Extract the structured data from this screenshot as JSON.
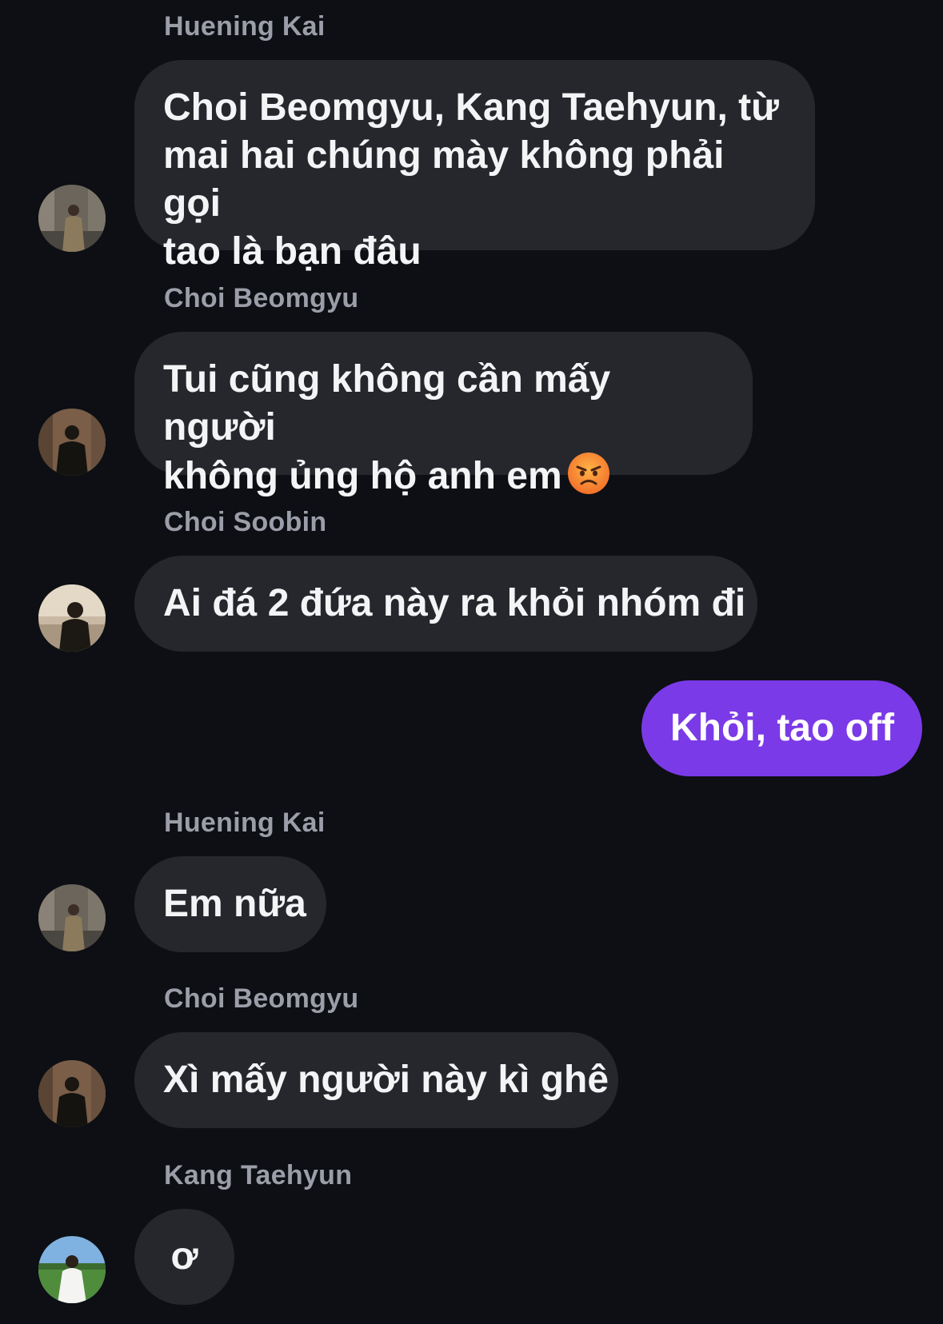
{
  "messages": [
    {
      "sender": "Huening Kai",
      "avatar_icon": "avatar-huening-kai-icon",
      "lines": [
        "Choi Beomgyu, Kang Taehyun, từ",
        "mai hai chúng mày không phải gọi",
        "tao là bạn đâu"
      ]
    },
    {
      "sender": "Choi Beomgyu",
      "avatar_icon": "avatar-choi-beomgyu-icon",
      "lines": [
        "Tui cũng không cần mấy người",
        "không ủng hộ anh em"
      ],
      "emoji": "angry-face-emoji"
    },
    {
      "sender": "Choi Soobin",
      "avatar_icon": "avatar-choi-soobin-icon",
      "text": "Ai đá 2 đứa này ra khỏi nhóm đi"
    },
    {
      "own": true,
      "text": "Khỏi, tao off"
    },
    {
      "sender": "Huening Kai",
      "avatar_icon": "avatar-huening-kai-icon",
      "text": "Em nữa"
    },
    {
      "sender": "Choi Beomgyu",
      "avatar_icon": "avatar-choi-beomgyu-icon",
      "text": "Xì mấy người này kì ghê"
    },
    {
      "sender": "Kang Taehyun",
      "avatar_icon": "avatar-kang-taehyun-icon",
      "text": "ơ"
    }
  ],
  "colors": {
    "background": "#0d0f14",
    "incoming_bubble": "#25272c",
    "outgoing_bubble": "#7b3ae8",
    "sender_name": "#9b9ea8",
    "text": "#f3f4f6"
  }
}
